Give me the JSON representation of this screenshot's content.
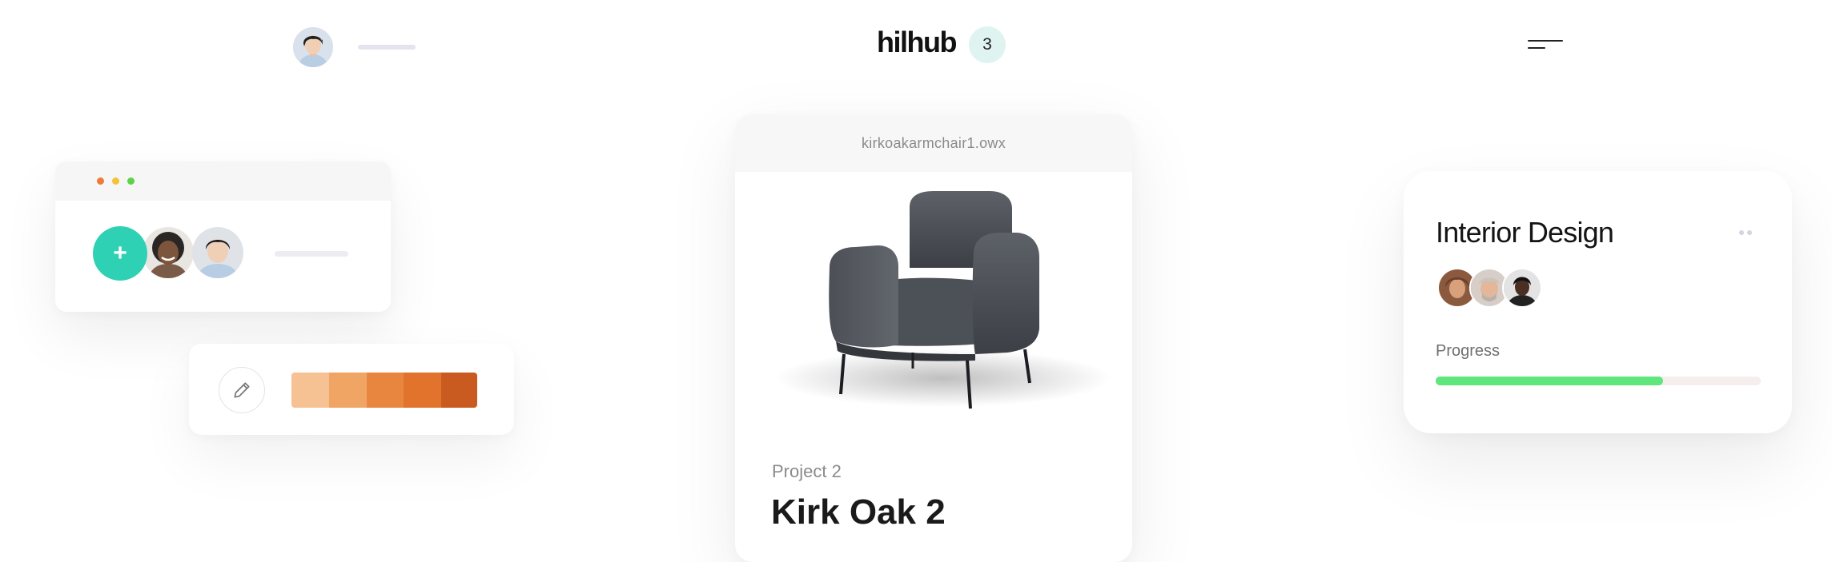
{
  "header": {
    "logo_text": "hilhub",
    "notification_count": "3",
    "user_avatar_icon": "user-avatar",
    "menu_icon": "menu-icon"
  },
  "window_card": {
    "traffic_light_colors": [
      "#f07a3a",
      "#f3c33a",
      "#5ed24a"
    ],
    "add_label": "+",
    "add_color": "#2fd1b4",
    "members": [
      "member-avatar-1",
      "member-avatar-2"
    ]
  },
  "palette": {
    "edit_icon": "pencil-icon",
    "swatches": [
      "#f6c193",
      "#f1a565",
      "#e8863f",
      "#e1732c",
      "#c95b20"
    ]
  },
  "product": {
    "file_name": "kirkoakarmchair1.owx",
    "image_icon": "armchair-image",
    "project_label": "Project 2",
    "title": "Kirk Oak 2"
  },
  "design_card": {
    "title": "Interior Design",
    "team": [
      "team-avatar-1",
      "team-avatar-2",
      "team-avatar-3"
    ],
    "progress_label": "Progress",
    "progress_value": 0.7,
    "progress_color": "#5fe67c"
  }
}
